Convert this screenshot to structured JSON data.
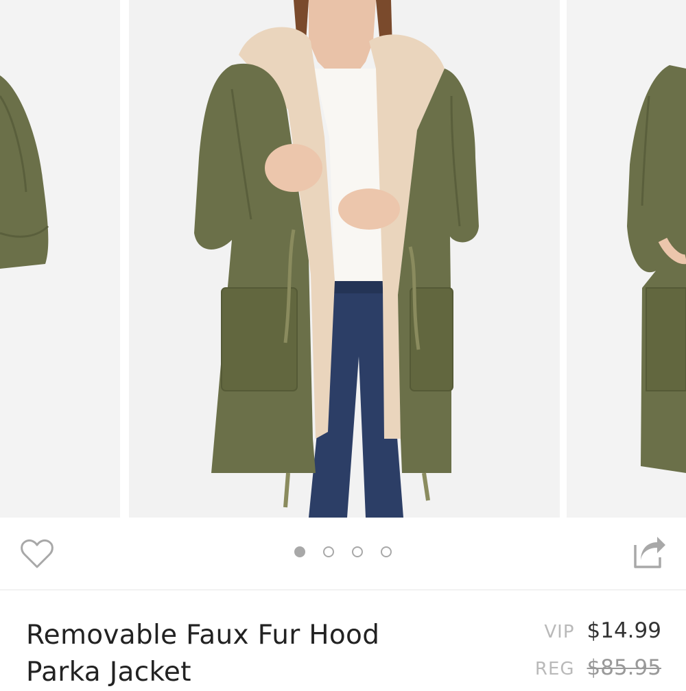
{
  "carousel": {
    "images": [
      {
        "alt": "Parka jacket side view"
      },
      {
        "alt": "Model wearing olive parka with faux fur hood"
      },
      {
        "alt": "Parka jacket pocket detail"
      }
    ],
    "dots_count": 4,
    "active_index": 0
  },
  "product": {
    "title": "Removable Faux Fur Hood Parka Jacket",
    "vip_label": "VIP",
    "vip_price": "$14.99",
    "reg_label": "REG",
    "reg_price": "$85.95"
  },
  "colors": {
    "coat": "#6b7049",
    "fur": "#ead5bd",
    "denim": "#2c3e66",
    "icon_gray": "#a8a8a8"
  },
  "icons": {
    "favorite": "heart-outline-icon",
    "share": "share-arrow-icon"
  }
}
